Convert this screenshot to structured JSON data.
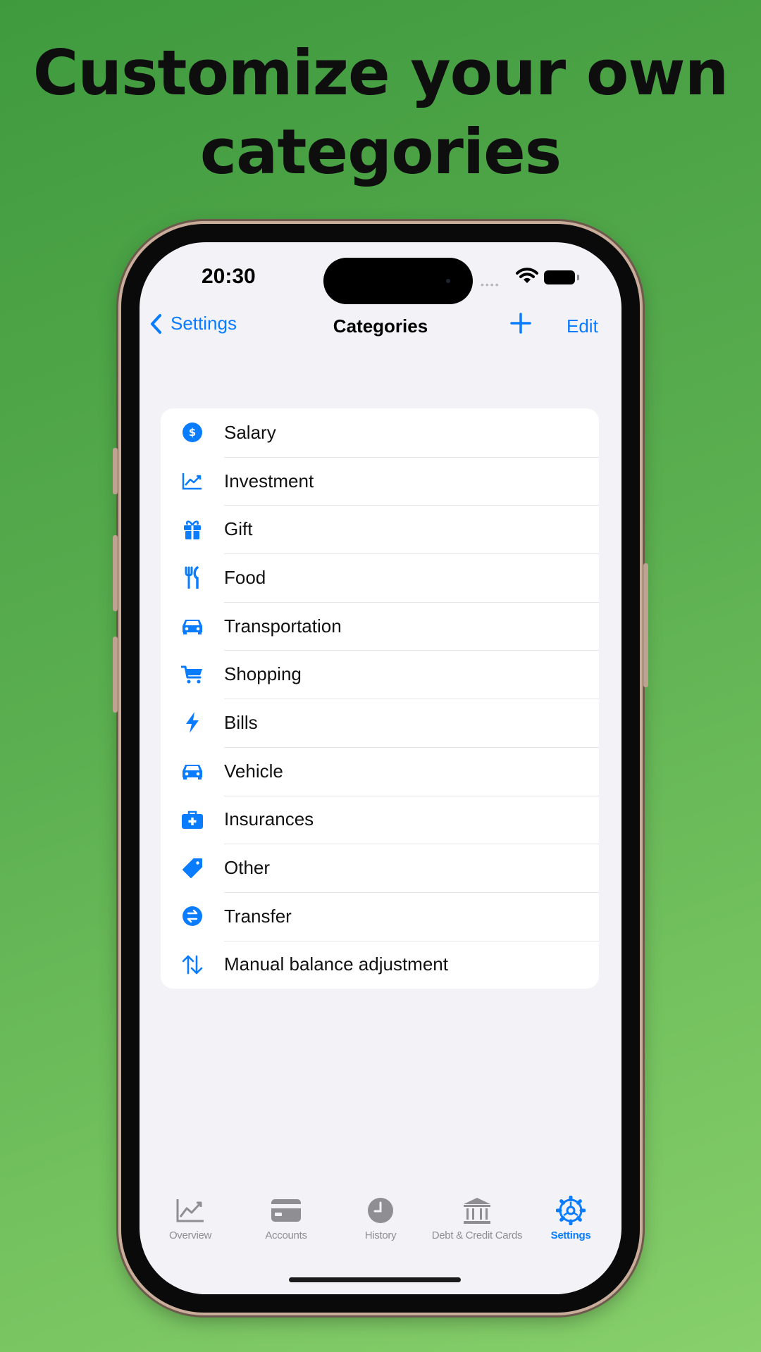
{
  "headline": {
    "line1": "Customize your own",
    "line2": "categories"
  },
  "status_bar": {
    "time": "20:30"
  },
  "nav": {
    "back_label": "Settings",
    "title": "Categories",
    "edit_label": "Edit"
  },
  "categories": [
    {
      "label": "Salary",
      "icon": "dollar-circle-icon"
    },
    {
      "label": "Investment",
      "icon": "chart-line-icon"
    },
    {
      "label": "Gift",
      "icon": "gift-icon"
    },
    {
      "label": "Food",
      "icon": "fork-knife-icon"
    },
    {
      "label": "Transportation",
      "icon": "car-icon"
    },
    {
      "label": "Shopping",
      "icon": "cart-icon"
    },
    {
      "label": "Bills",
      "icon": "bolt-icon"
    },
    {
      "label": "Vehicle",
      "icon": "car-icon"
    },
    {
      "label": "Insurances",
      "icon": "medical-case-icon"
    },
    {
      "label": "Other",
      "icon": "tag-icon"
    },
    {
      "label": "Transfer",
      "icon": "transfer-circle-icon"
    },
    {
      "label": "Manual balance adjustment",
      "icon": "arrows-up-down-icon"
    }
  ],
  "tabbar": {
    "items": [
      {
        "label": "Overview",
        "icon": "chart-icon",
        "active": false
      },
      {
        "label": "Accounts",
        "icon": "credit-card-icon",
        "active": false
      },
      {
        "label": "History",
        "icon": "clock-icon",
        "active": false
      },
      {
        "label": "Debt & Credit Cards",
        "icon": "bank-icon",
        "active": false
      },
      {
        "label": "Settings",
        "icon": "gear-icon",
        "active": true
      }
    ]
  },
  "colors": {
    "accent": "#0A7CFF",
    "background_green": "#5AAE4F",
    "screen_bg": "#F2F2F7",
    "inactive_tab": "#8E8E93"
  }
}
